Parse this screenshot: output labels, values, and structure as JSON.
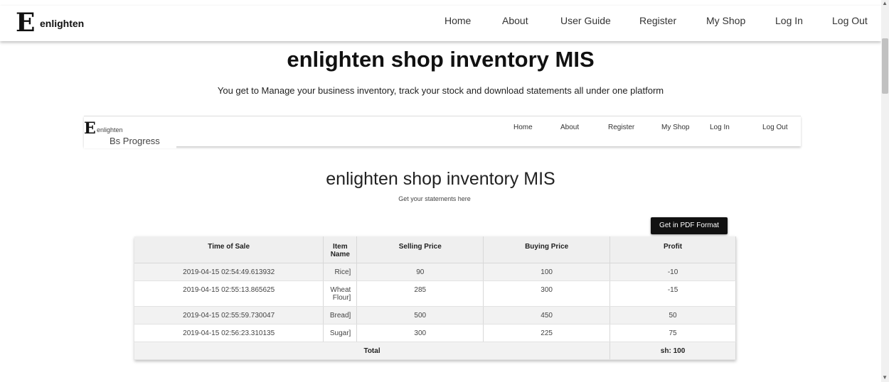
{
  "nav": {
    "logo_letter": "E",
    "brand": "enlighten",
    "links": [
      "Home",
      "About",
      "User Guide",
      "Register",
      "My Shop",
      "Log In",
      "Log Out"
    ]
  },
  "hero": {
    "title": "enlighten shop inventory MIS",
    "subtitle": "You get to Manage your business inventory, track your stock and download statements all under one platform"
  },
  "preview": {
    "logo_letter": "E",
    "brand": "enlighten",
    "tab_title": "Bs Progress",
    "links": [
      "Home",
      "About",
      "Register",
      "My Shop",
      "Log In",
      "Log Out"
    ],
    "title": "enlighten shop inventory MIS",
    "subtitle": "Get your statements here",
    "pdf_button": "Get in PDF Format",
    "table": {
      "headers": [
        "Time of Sale",
        "Item Name",
        "Selling Price",
        "Buying Price",
        "Profit"
      ],
      "rows": [
        [
          "2019-04-15 02:54:49.613932",
          "Rice]",
          "90",
          "100",
          "-10"
        ],
        [
          "2019-04-15 02:55:13.865625",
          "Wheat Flour]",
          "285",
          "300",
          "-15"
        ],
        [
          "2019-04-15 02:55:59.730047",
          "Bread]",
          "500",
          "450",
          "50"
        ],
        [
          "2019-04-15 02:56:23.310135",
          "Sugar]",
          "300",
          "225",
          "75"
        ]
      ],
      "total_label": "Total",
      "total_value": "sh: 100"
    }
  }
}
